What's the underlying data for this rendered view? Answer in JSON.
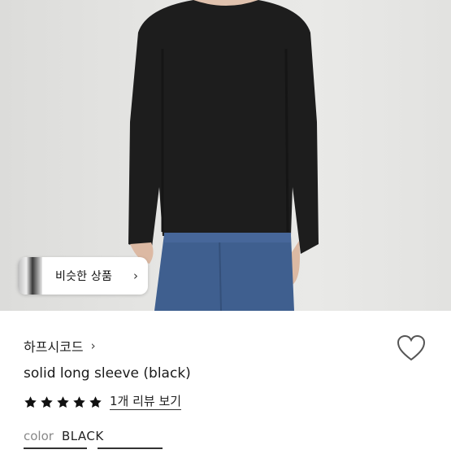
{
  "similar": {
    "label": "비슷한 상품",
    "arrow_icon": "chevron-right"
  },
  "product": {
    "brand": "하프시코드",
    "brand_chevron_icon": "chevron-right",
    "title": "solid long sleeve (black)",
    "rating_stars": 5,
    "rating_max": 5,
    "review_link": "1개 리뷰 보기",
    "color_label": "color",
    "color_value": "BLACK",
    "like_icon": "heart-outline"
  },
  "colors": {
    "star": "#111111",
    "heart_stroke": "#555555",
    "text_muted": "#888888"
  }
}
